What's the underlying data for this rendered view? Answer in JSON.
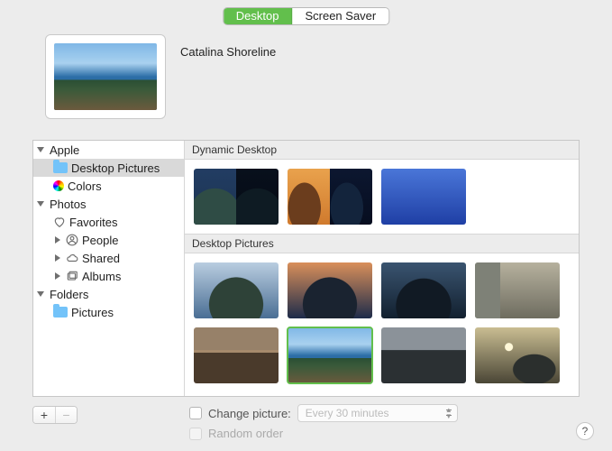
{
  "tabs": {
    "desktop": "Desktop",
    "screensaver": "Screen Saver"
  },
  "current_wallpaper_name": "Catalina Shoreline",
  "sidebar": {
    "apple": {
      "label": "Apple",
      "desktop_pictures": "Desktop Pictures",
      "colors": "Colors"
    },
    "photos": {
      "label": "Photos",
      "favorites": "Favorites",
      "people": "People",
      "shared": "Shared",
      "albums": "Albums"
    },
    "folders": {
      "label": "Folders",
      "pictures": "Pictures"
    }
  },
  "groups": {
    "dynamic": {
      "label": "Dynamic Desktop"
    },
    "desktop_pictures": {
      "label": "Desktop Pictures"
    }
  },
  "bottom": {
    "change_label": "Change picture:",
    "interval": "Every 30 minutes",
    "random_label": "Random order"
  }
}
